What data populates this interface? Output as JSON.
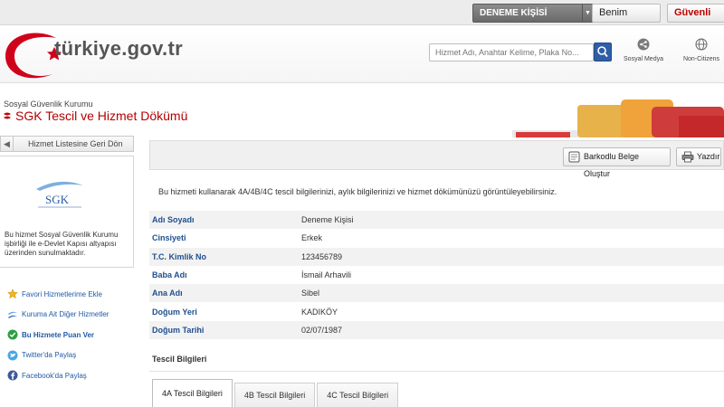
{
  "topbar": {
    "user_name": "DENEME KİŞİSİ",
    "my_page_label": "Benim Sayfam",
    "logout_label": "Güvenli Çıkış"
  },
  "header": {
    "logo_text": "türkiye.gov.tr",
    "search_placeholder": "Hizmet Adı, Anahtar Kelime, Plaka No...",
    "social_label": "Sosyal Medya",
    "non_citizens_label": "Non-Citizens"
  },
  "page": {
    "organization": "Sosyal Güvenlik Kurumu",
    "title": "SGK Tescil ve Hizmet Dökümü"
  },
  "sidebar": {
    "back_label": "Hizmet Listesine Geri Dön",
    "logo_text": "SGK",
    "description": "Bu hizmet Sosyal Güvenlik Kurumu işbirliği ile e-Devlet Kapısı altyapısı üzerinden sunulmaktadır.",
    "items": [
      {
        "label": "Favori Hizmetlerime Ekle",
        "icon": "star-icon"
      },
      {
        "label": "Kuruma Ait Diğer Hizmetler",
        "icon": "institution-icon"
      },
      {
        "label": "Bu Hizmete Puan Ver",
        "icon": "rate-icon"
      },
      {
        "label": "Twitter'da Paylaş",
        "icon": "twitter-icon"
      },
      {
        "label": "Facebook'da Paylaş",
        "icon": "facebook-icon"
      }
    ]
  },
  "main": {
    "toolbar": {
      "barcode_label": "Barkodlu Belge Oluştur",
      "print_label": "Yazdır"
    },
    "intro": "Bu hizmeti kullanarak 4A/4B/4C tescil bilgilerinizi, aylık bilgilerinizi ve hizmet dökümünüzü görüntüleyebilirsiniz.",
    "info": [
      {
        "label": "Adı Soyadı",
        "value": "Deneme Kişisi"
      },
      {
        "label": "Cinsiyeti",
        "value": "Erkek"
      },
      {
        "label": "T.C. Kimlik No",
        "value": "123456789"
      },
      {
        "label": "Baba Adı",
        "value": "İsmail Arhavili"
      },
      {
        "label": "Ana Adı",
        "value": "Sibel"
      },
      {
        "label": "Doğum Yeri",
        "value": "KADIKÖY"
      },
      {
        "label": "Doğum Tarihi",
        "value": "02/07/1987"
      }
    ],
    "section_title": "Tescil Bilgileri",
    "tabs": [
      {
        "label": "4A Tescil Bilgileri",
        "active": true
      },
      {
        "label": "4B Tescil Bilgileri",
        "active": false
      },
      {
        "label": "4C Tescil Bilgileri",
        "active": false
      }
    ]
  },
  "colors": {
    "brand_red": "#b30000",
    "link_blue": "#1f5aa6",
    "search_button": "#2f5ea8"
  }
}
